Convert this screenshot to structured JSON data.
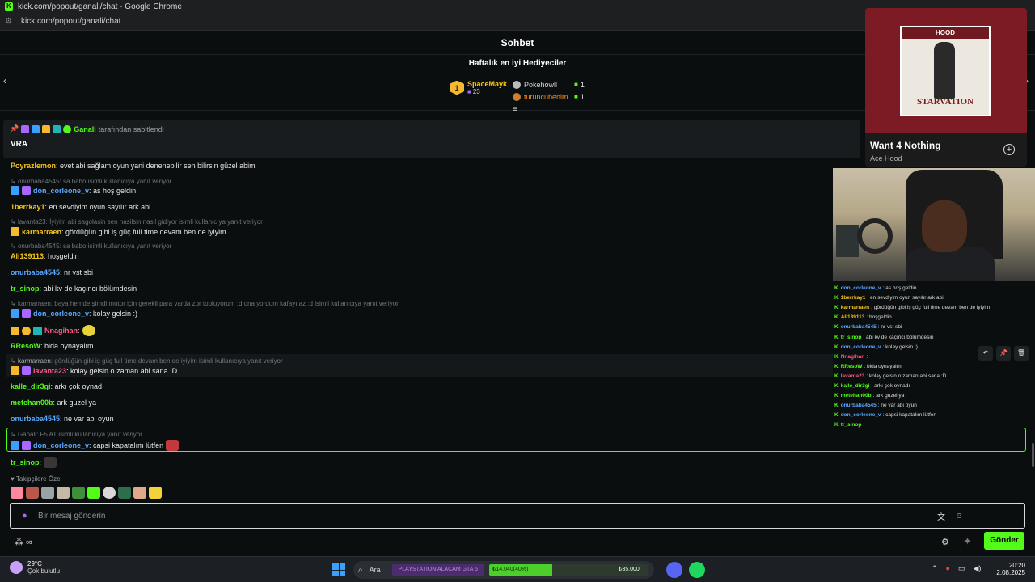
{
  "browser": {
    "title": "kick.com/popout/ganali/chat - Google Chrome",
    "url": "kick.com/popout/ganali/chat"
  },
  "chat": {
    "header": "Sohbet",
    "gifters_heading": "Haftalık en iyi Hediyeciler",
    "top_gifter": {
      "rank": "1",
      "name": "SpaceMayk",
      "count": "23"
    },
    "gifters": [
      {
        "name": "Pokehowll",
        "count": "1",
        "color": "#d6d6d6"
      },
      {
        "name": "turuncubenim",
        "count": "1",
        "color": "#ff8a1c"
      }
    ],
    "pinned": {
      "pinner": "Ganali",
      "suffix": "tarafından sabitlendi",
      "message": "VRA"
    },
    "messages": [
      {
        "user": "Poyrazlemon",
        "text": ": evet abi sağlam oyun yani denenebilir sen bilirsin güzel abim",
        "color": "#f5c518"
      },
      {
        "reply": "onurbaba4545: sa babo isimli kullanıcıya yanıt veriyor"
      },
      {
        "user": "don_corleone_v",
        "text": ": as hoş geldin",
        "color": "#5aa8ff"
      },
      {
        "user": "1berrkay1",
        "text": ": en sevdiyim oyun sayılır ark abi",
        "color": "#f5c518"
      },
      {
        "reply": "lavanta23: İyiyim abi sagolasin sen nasilsin nasil gidiyor isimli kullanıcıya yanıt veriyor"
      },
      {
        "user": "karmarraen",
        "text": ": gördüğün gibi iş güç full time devam ben de iyiyim",
        "color": "#f5c518"
      },
      {
        "reply": "onurbaba4545: sa babo isimli kullanıcıya yanıt veriyor"
      },
      {
        "user": "Ali139113",
        "text": ": hoşgeldin",
        "color": "#f5c518"
      },
      {
        "user": "onurbaba4545",
        "text": ": nr vst sbi",
        "color": "#5aa8ff"
      },
      {
        "user": "tr_sinop",
        "text": ": abi kv de kaçıncı bölümdesin",
        "color": "#53fc18"
      },
      {
        "reply": "karmarraen: baya hemde şimdi motor için gerekli para varda zor topluyorum :d ona yordum kafayı az :d isimli kullanıcıya yanıt veriyor"
      },
      {
        "user": "don_corleone_v",
        "text": ": kolay gelsin :)",
        "color": "#5aa8ff"
      },
      {
        "user": "Nnagihan",
        "text": ":",
        "color": "#ff5a8a"
      },
      {
        "user": "RResoW",
        "text": ": bida oynayalım",
        "color": "#53fc18"
      },
      {
        "reply_user": "karmarraen",
        "reply_text": ": gördüğün gibi iş güç full time devam ben de iyiyim isimli kullanıcıya yanıt veriyor"
      },
      {
        "user": "lavanta23",
        "text": ": kolay gelsin o zaman abi sana :D",
        "color": "#ff5a8a"
      },
      {
        "user": "kalle_dir3gi",
        "text": ": arkı çok oynadı",
        "color": "#53fc18"
      },
      {
        "user": "metehan00b",
        "text": ": ark guzel ya",
        "color": "#53fc18"
      },
      {
        "user": "onurbaba4545",
        "text": ": ne var abi oyun",
        "color": "#5aa8ff"
      },
      {
        "reply": "Ganali: F5 AT isimli kullanıcıya yanıt veriyor"
      },
      {
        "user": "don_corleone_v",
        "text": ": capsi kapatalım lütfen",
        "color": "#5aa8ff"
      },
      {
        "user": "tr_sinop",
        "text": ":",
        "color": "#53fc18"
      }
    ],
    "follower_label": "Takipçilere Özel",
    "input_placeholder": "Bir mesaj gönderin",
    "send_label": "Gönder"
  },
  "music": {
    "album_text": "STARVATION",
    "album_band": "HOOD",
    "title": "Want 4 Nothing",
    "artist": "Ace Hood"
  },
  "mini_chat": [
    {
      "user": "don_corleone_v",
      "text": ": as hoş geldin",
      "color": "#5aa8ff"
    },
    {
      "user": "1berrkay1",
      "text": ": en sevdiyim oyun sayılır ark abi",
      "color": "#f5c518"
    },
    {
      "user": "karmarraen",
      "text": ": gördüğün gibi iş güç full time devam ben de iyiyim",
      "color": "#f5c518"
    },
    {
      "user": "Ali139113",
      "text": ": hoşgeldin",
      "color": "#f5c518"
    },
    {
      "user": "onurbaba4545",
      "text": ": nr vst sbi",
      "color": "#5aa8ff"
    },
    {
      "user": "tr_sinop",
      "text": ": abi kv de kaçıncı bölümdesin",
      "color": "#53fc18"
    },
    {
      "user": "don_corleone_v",
      "text": ": kolay gelsin :)",
      "color": "#5aa8ff"
    },
    {
      "user": "Nnagihan",
      "text": ":",
      "color": "#ff5a8a"
    },
    {
      "user": "RResoW",
      "text": ": bida oynayalım",
      "color": "#53fc18"
    },
    {
      "user": "lavanta23",
      "text": ": kolay gelsin o zaman abi sana :D",
      "color": "#ff5a8a"
    },
    {
      "user": "kalle_dir3gi",
      "text": ": arkı çok oynadı",
      "color": "#53fc18"
    },
    {
      "user": "metehan00b",
      "text": ": ark guzel ya",
      "color": "#53fc18"
    },
    {
      "user": "onurbaba4545",
      "text": ": ne var abi oyun",
      "color": "#5aa8ff"
    },
    {
      "user": "don_corleone_v",
      "text": ": capsi kapatalım lütfen",
      "color": "#5aa8ff"
    },
    {
      "user": "tr_sinop",
      "text": ":",
      "color": "#53fc18"
    }
  ],
  "taskbar": {
    "temperature": "29°C",
    "weather": "Çok bulutlu",
    "search_label": "Ara",
    "promo": "PLAYSTATION ALACAM GTA 6",
    "goal_current": "₺14.040(40%)",
    "goal_target": "₺35.000",
    "goal_fraction": 0.4,
    "time": "20:20",
    "date": "2.08.2025"
  },
  "colors": {
    "accent": "#53fc18",
    "background": "#0b0e0f"
  }
}
